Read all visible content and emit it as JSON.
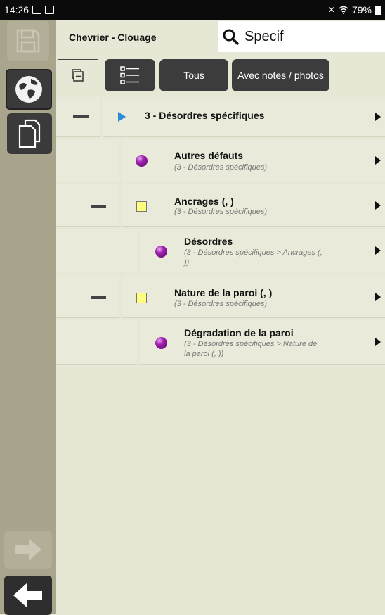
{
  "status_bar": {
    "time": "14:26",
    "battery": "79%",
    "icons": [
      "gallery-icon",
      "screenshot-icon",
      "mute-icon",
      "wifi-icon",
      "battery-icon"
    ]
  },
  "sidebar": {
    "buttons": [
      "save-icon",
      "globe-icon",
      "copy-icon",
      "arrow-right-icon",
      "arrow-left-icon"
    ]
  },
  "header": {
    "title": "Chevrier - Clouage",
    "search_value": "Specif"
  },
  "toolbar": {
    "tab_collapse_icon": "collapse-icon",
    "tab_list_icon": "list-icon",
    "tab_all": "Tous",
    "tab_notes": "Avec notes / photos"
  },
  "tree": {
    "root": {
      "title": "3 - Désordres spécifiques"
    },
    "items": [
      {
        "title": "Autres défauts",
        "path": "(3 - Désordres spécifiques)"
      },
      {
        "title": "Ancrages (, )",
        "path": "(3 - Désordres spécifiques)"
      },
      {
        "title": "Désordres",
        "path_line1": "(3 - Désordres spécifiques > Ancrages (,",
        "path_line2": "))"
      },
      {
        "title": "Nature de la paroi (, )",
        "path": "(3 - Désordres spécifiques)"
      },
      {
        "title": "Dégradation de la paroi",
        "path_line1": "(3 - Désordres spécifiques > Nature de",
        "path_line2": "la paroi (, ))"
      }
    ]
  },
  "colors": {
    "background": "#e6e7d4",
    "sidebar": "#a9a48c",
    "button_dark": "#3c3c3c",
    "accent_blue": "#2a8bd8",
    "item_purple": "#a020b0",
    "item_yellow": "#fffe80"
  }
}
